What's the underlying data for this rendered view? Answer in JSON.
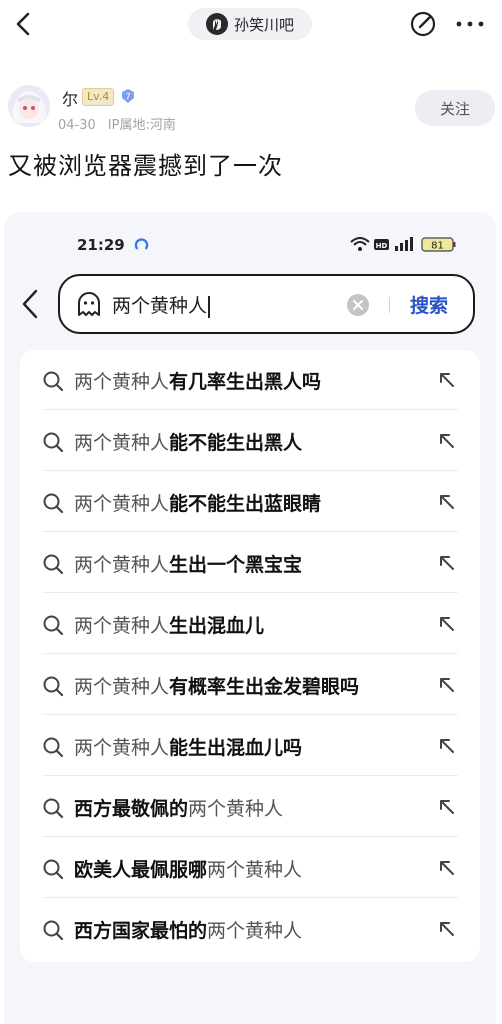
{
  "topbar": {
    "forum_name": "孙笑川吧"
  },
  "author": {
    "name": "尔",
    "level": "Lv.4",
    "date": "04-30",
    "ip": "IP属地:河南",
    "follow_label": "关注"
  },
  "post": {
    "title": "又被浏览器震撼到了一次"
  },
  "screenshot": {
    "status_time": "21:29",
    "battery": "81",
    "search_query": "两个黄种人",
    "search_button": "搜索",
    "suggestions": [
      {
        "prefix": "两个黄种人",
        "suffix": "有几率生出黑人吗"
      },
      {
        "prefix": "两个黄种人",
        "suffix": "能不能生出黑人"
      },
      {
        "prefix": "两个黄种人",
        "suffix": "能不能生出蓝眼睛"
      },
      {
        "prefix": "两个黄种人",
        "suffix": "生出一个黑宝宝"
      },
      {
        "prefix": "两个黄种人",
        "suffix": "生出混血儿"
      },
      {
        "prefix": "两个黄种人",
        "suffix": "有概率生出金发碧眼吗"
      },
      {
        "prefix": "两个黄种人",
        "suffix": "能生出混血儿吗"
      },
      {
        "lead": "西方最敬佩的",
        "tail": "两个黄种人"
      },
      {
        "lead": "欧美人最佩服哪",
        "tail": "两个黄种人"
      },
      {
        "lead": "西方国家最怕的",
        "tail": "两个黄种人"
      }
    ]
  },
  "colors": {
    "accent": "#2a53c9",
    "follow_bg": "#eceef4",
    "level_bg": "#f1e8c8",
    "meta": "#a3a3a3"
  }
}
